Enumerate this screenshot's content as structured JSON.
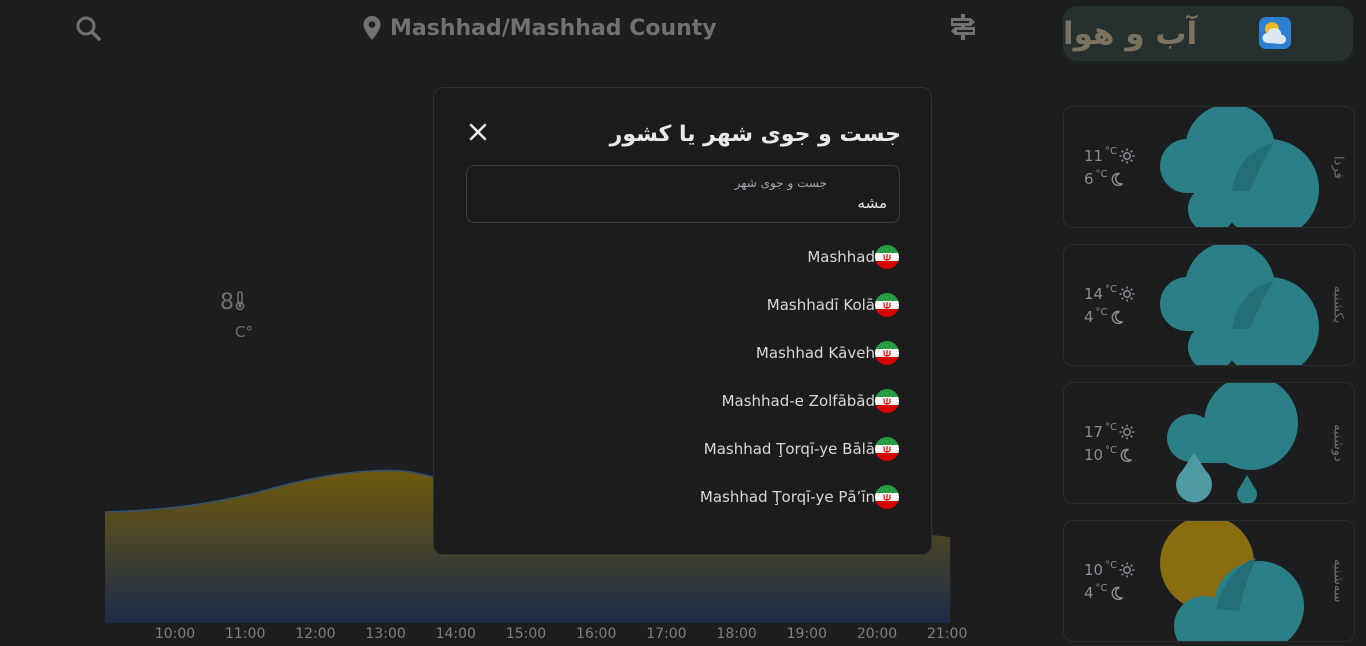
{
  "header": {
    "location": "Mashhad/Mashhad County"
  },
  "app": {
    "title": "آب و هوا"
  },
  "current": {
    "temperature": "8",
    "unit": "C°"
  },
  "chart_data": {
    "type": "area",
    "x": [
      "10:00",
      "11:00",
      "12:00",
      "13:00",
      "14:00",
      "15:00",
      "16:00",
      "17:00",
      "18:00",
      "19:00",
      "20:00",
      "21:00"
    ]
  },
  "forecast": [
    {
      "day": "فردا",
      "high": "11",
      "low": "6",
      "icon": "cloud-icon"
    },
    {
      "day": "یکشنبه",
      "high": "14",
      "low": "4",
      "icon": "cloud-icon"
    },
    {
      "day": "دوشنبه",
      "high": "17",
      "low": "10",
      "icon": "rain-cloud-icon"
    },
    {
      "day": "سه‌شنبه",
      "high": "10",
      "low": "4",
      "icon": "partly-sunny-icon"
    }
  ],
  "units": {
    "deg": "°C"
  },
  "modal": {
    "title": "جست و جوی شهر یا کشور",
    "search_label": "جست و جوی شهر",
    "search_value": "مشه",
    "results": [
      "Mashhad",
      "Mashhadī Kolā",
      "Mashhad Kāveh",
      "Mashhad-e Zolfābād",
      "Mashhad Ţorqī-ye Bālā",
      "Mashhad Ţorqī-ye Pā’īn"
    ]
  },
  "colors": {
    "accent_cloud": "#2b7f87",
    "sun": "#8a6d10",
    "background": "#1d1e1f"
  }
}
